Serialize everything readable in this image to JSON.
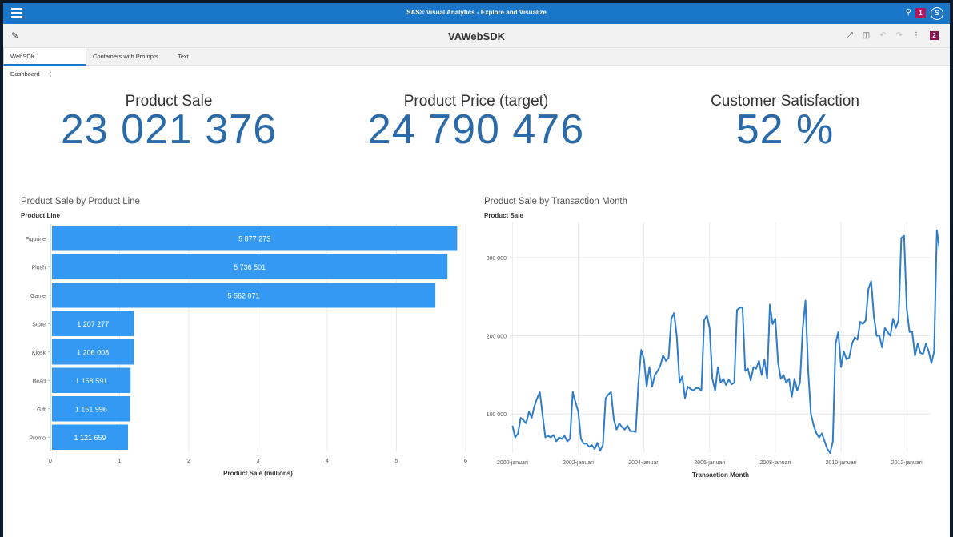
{
  "app_title": "SAS® Visual Analytics - Explore and Visualize",
  "notif_count": "1",
  "user_initial": "S",
  "report_title": "VAWebSDK",
  "tools": {
    "badge": "2"
  },
  "tabs": [
    {
      "label": "WebSDK Dashboard"
    },
    {
      "label": "Containers with Prompts"
    },
    {
      "label": "Text"
    }
  ],
  "kpis": [
    {
      "title": "Product Sale",
      "value": "23 021 376"
    },
    {
      "title": "Product Price (target)",
      "value": "24 790 476"
    },
    {
      "title": "Customer Satisfaction",
      "value": "52 %"
    }
  ],
  "colors": {
    "bar": "#3399f3",
    "line": "#2f7cc8",
    "kpi": "#2a6aa8",
    "header": "#1976c9"
  },
  "chart_data": [
    {
      "type": "bar",
      "title": "Product Sale by Product Line",
      "ylabel": "Product Line",
      "xlabel": "Product Sale (millions)",
      "categories": [
        "Figurine",
        "Plush",
        "Game",
        "Store",
        "Kiosk",
        "Bead",
        "Gift",
        "Promo"
      ],
      "values": [
        5.877273,
        5.736501,
        5.562071,
        1.207277,
        1.206008,
        1.158591,
        1.151996,
        1.121659
      ],
      "data_labels": [
        "5 877 273",
        "5 736 501",
        "5 562 071",
        "1 207 277",
        "1 206 008",
        "1 158 591",
        "1 151 996",
        "1 121 659"
      ],
      "xlim": [
        0,
        6
      ],
      "xticks": [
        0,
        1,
        2,
        3,
        4,
        5,
        6
      ],
      "grid": true
    },
    {
      "type": "line",
      "title": "Product Sale by Transaction Month",
      "ylabel": "Product Sale",
      "xlabel": "Transaction Month",
      "x_start": "2000-01",
      "x_tick_labels": [
        "2000-januari",
        "2002-januari",
        "2004-januari",
        "2006-januari",
        "2008-januari",
        "2010-januari",
        "2012-januari"
      ],
      "x_tick_positions": [
        0,
        24,
        48,
        72,
        96,
        120,
        144
      ],
      "xlim": [
        -1,
        153
      ],
      "y_ticks": [
        100000,
        200000,
        300000
      ],
      "y_tick_labels": [
        "100 000",
        "200 000",
        "300 000"
      ],
      "ylim": [
        50000,
        345000
      ],
      "grid": true,
      "values": [
        85000,
        70000,
        75000,
        95000,
        92000,
        88000,
        103000,
        95000,
        110000,
        120000,
        128000,
        98000,
        70000,
        72000,
        70000,
        73000,
        65000,
        70000,
        68000,
        72000,
        65000,
        68000,
        128000,
        115000,
        103000,
        68000,
        62000,
        62000,
        58000,
        60000,
        55000,
        63000,
        53000,
        60000,
        120000,
        125000,
        128000,
        93000,
        80000,
        88000,
        83000,
        80000,
        85000,
        78000,
        78000,
        77000,
        140000,
        182000,
        170000,
        135000,
        160000,
        135000,
        150000,
        155000,
        162000,
        175000,
        168000,
        172000,
        222000,
        229000,
        200000,
        140000,
        148000,
        120000,
        135000,
        132000,
        130000,
        133000,
        133000,
        130000,
        220000,
        226000,
        210000,
        145000,
        130000,
        160000,
        140000,
        145000,
        137000,
        144000,
        138000,
        140000,
        233000,
        236000,
        236000,
        155000,
        158000,
        143000,
        160000,
        158000,
        168000,
        150000,
        170000,
        145000,
        240000,
        215000,
        222000,
        165000,
        145000,
        150000,
        140000,
        145000,
        122000,
        145000,
        130000,
        140000,
        210000,
        245000,
        155000,
        100000,
        85000,
        75000,
        70000,
        75000,
        65000,
        55000,
        50000,
        65000,
        190000,
        205000,
        160000,
        180000,
        170000,
        172000,
        190000,
        198000,
        195000,
        218000,
        215000,
        220000,
        260000,
        270000,
        225000,
        200000,
        200000,
        185000,
        210000,
        205000,
        200000,
        222000,
        210000,
        220000,
        325000,
        328000,
        235000,
        205000,
        205000,
        175000,
        190000,
        178000,
        177000,
        190000,
        180000,
        165000,
        180000,
        335000,
        310000
      ]
    }
  ]
}
